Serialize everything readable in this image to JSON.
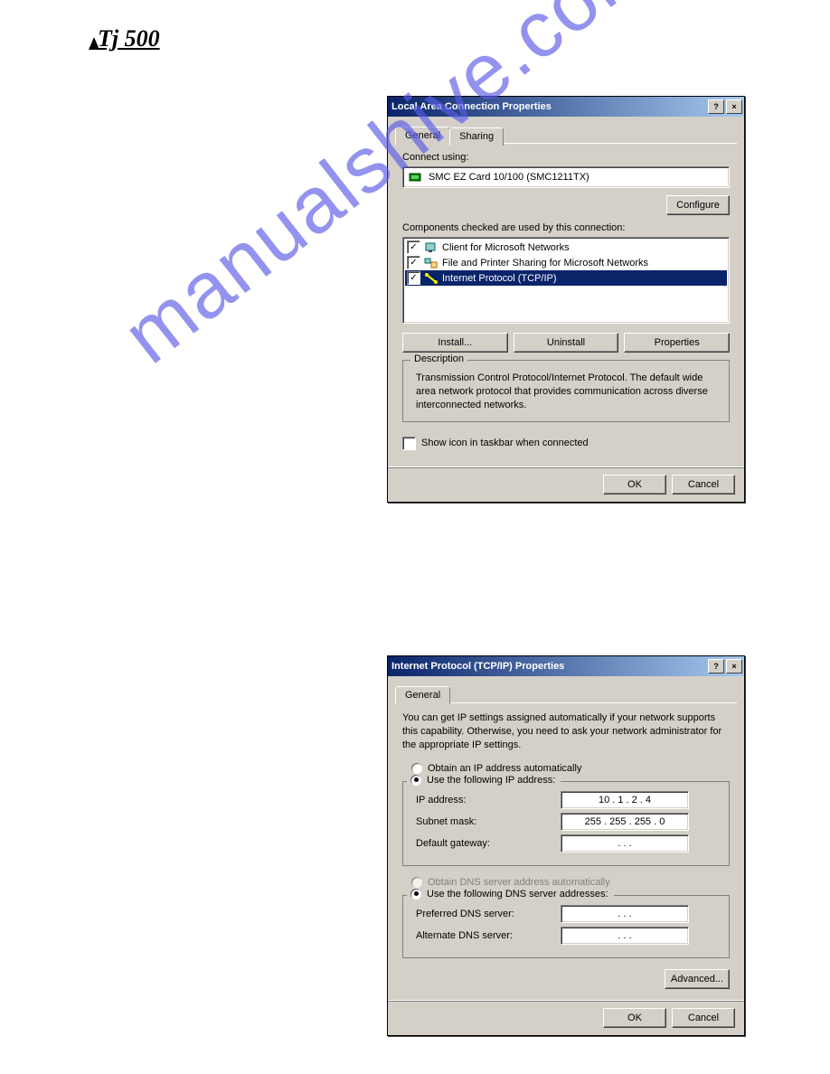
{
  "logo": "Tj 500",
  "watermark": "manualshive.com",
  "dialog1": {
    "title": "Local Area Connection Properties",
    "help": "?",
    "close": "×",
    "tabs": {
      "general": "General",
      "sharing": "Sharing"
    },
    "connect_using_label": "Connect using:",
    "adapter": "SMC EZ Card 10/100 (SMC1211TX)",
    "configure_btn": "Configure",
    "components_label": "Components checked are used by this connection:",
    "items": {
      "a": "Client for Microsoft Networks",
      "b": "File and Printer Sharing for Microsoft Networks",
      "c": "Internet Protocol (TCP/IP)"
    },
    "install_btn": "Install...",
    "uninstall_btn": "Uninstall",
    "properties_btn": "Properties",
    "desc_legend": "Description",
    "desc_text": "Transmission Control Protocol/Internet Protocol. The default wide area network protocol that provides communication across diverse interconnected networks.",
    "show_icon": "Show icon in taskbar when connected",
    "ok": "OK",
    "cancel": "Cancel"
  },
  "dialog2": {
    "title": "Internet Protocol (TCP/IP) Properties",
    "help": "?",
    "close": "×",
    "tab": "General",
    "intro": "You can get IP settings assigned automatically if your network supports this capability. Otherwise, you need to ask your network administrator for the appropriate IP settings.",
    "radio_auto": "Obtain an IP address automatically",
    "radio_manual": "Use the following IP address:",
    "ip_label": "IP address:",
    "ip_value": "10 . 1 . 2 . 4",
    "mask_label": "Subnet mask:",
    "mask_value": "255 . 255 . 255 . 0",
    "gw_label": "Default gateway:",
    "gw_value": ".       .       .",
    "radio_dns_auto": "Obtain DNS server address automatically",
    "radio_dns_manual": "Use the following DNS server addresses:",
    "dns1_label": "Preferred DNS server:",
    "dns1_value": ".       .       .",
    "dns2_label": "Alternate DNS server:",
    "dns2_value": ".       .       .",
    "advanced_btn": "Advanced...",
    "ok": "OK",
    "cancel": "Cancel"
  }
}
